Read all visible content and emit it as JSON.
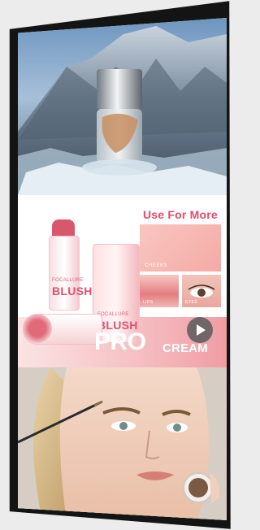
{
  "ad": {
    "top_panel": {
      "subject": "cosmetic-jar-on-ice"
    },
    "middle_panel": {
      "headline": "Use For More",
      "usage_labels": [
        "CHEEKS",
        "LIPS",
        "EYES"
      ],
      "product_brand": "FOCALLURE",
      "product_name": "BLUSH",
      "tagline_main": "PRO",
      "tagline_sub": "CREAM",
      "play_icon": "play-icon"
    },
    "bottom_panel": {
      "subject": "model-applying-eyebrow-pomade"
    }
  },
  "colors": {
    "frame": "#141414",
    "accent_pink": "#e44a6c",
    "blush_pink": "#f4aaa4",
    "stick_red": "#d9576a"
  }
}
